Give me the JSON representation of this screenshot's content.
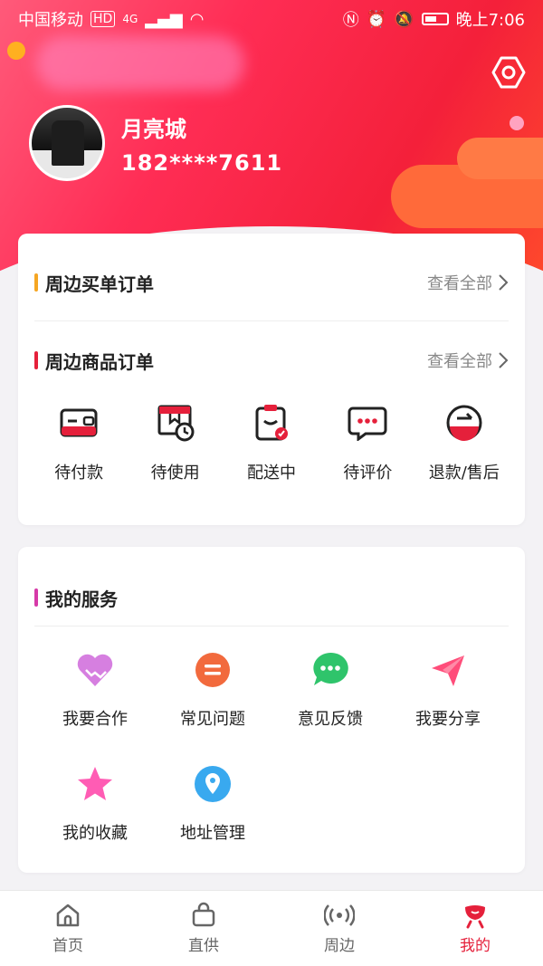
{
  "status_bar": {
    "carrier": "中国移动",
    "hd": "HD",
    "network": "4G",
    "time": "晚上7:06"
  },
  "profile": {
    "name": "月亮城",
    "phone": "182****7611"
  },
  "orders_card": {
    "nearby_purchase": {
      "title": "周边买单订单",
      "view_all": "查看全部",
      "accent": "#f5a623"
    },
    "nearby_goods": {
      "title": "周边商品订单",
      "view_all": "查看全部",
      "accent": "#e5203b"
    },
    "items": [
      {
        "label": "待付款",
        "icon": "wallet-icon"
      },
      {
        "label": "待使用",
        "icon": "package-clock-icon"
      },
      {
        "label": "配送中",
        "icon": "delivery-clipboard-icon"
      },
      {
        "label": "待评价",
        "icon": "chat-bubble-icon"
      },
      {
        "label": "退款/售后",
        "icon": "refund-icon"
      }
    ]
  },
  "services_card": {
    "title": "我的服务",
    "accent": "#d63aa8",
    "items": [
      {
        "label": "我要合作",
        "icon": "handshake-icon"
      },
      {
        "label": "常见问题",
        "icon": "faq-icon"
      },
      {
        "label": "意见反馈",
        "icon": "feedback-icon"
      },
      {
        "label": "我要分享",
        "icon": "share-icon"
      },
      {
        "label": "我的收藏",
        "icon": "star-icon"
      },
      {
        "label": "地址管理",
        "icon": "location-icon"
      }
    ]
  },
  "bottom_nav": {
    "items": [
      {
        "label": "首页",
        "icon": "home-icon"
      },
      {
        "label": "直供",
        "icon": "bag-icon"
      },
      {
        "label": "周边",
        "icon": "signal-icon"
      },
      {
        "label": "我的",
        "icon": "mine-icon"
      }
    ],
    "active_index": 3
  },
  "colors": {
    "brand_red": "#e5203b",
    "muted": "#888888"
  }
}
